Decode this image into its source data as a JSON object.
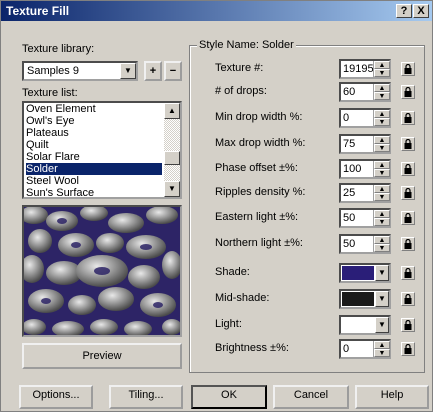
{
  "window": {
    "title": "Texture Fill"
  },
  "titlebar_buttons": {
    "help": "?",
    "close": "X"
  },
  "library": {
    "label": "Texture library:",
    "value": "Samples 9",
    "add": "+",
    "remove": "−"
  },
  "texture_list": {
    "label": "Texture list:",
    "items": [
      "Oven Element",
      "Owl's Eye",
      "Plateaus",
      "Quilt",
      "Solar Flare",
      "Solder",
      "Steel Wool",
      "Sun's Surface"
    ],
    "selected": "Solder"
  },
  "preview_button": "Preview",
  "style_group": {
    "title": "Style Name: Solder"
  },
  "params": [
    {
      "label": "Texture #:",
      "value": "19195"
    },
    {
      "label": "# of drops:",
      "value": "60"
    },
    {
      "label": "Min drop width %:",
      "value": "0"
    },
    {
      "label": "Max drop width %:",
      "value": "75"
    },
    {
      "label": "Phase offset ±%:",
      "value": "100"
    },
    {
      "label": "Ripples density %:",
      "value": "25"
    },
    {
      "label": "Eastern light ±%:",
      "value": "50"
    },
    {
      "label": "Northern light ±%:",
      "value": "50"
    }
  ],
  "colors": [
    {
      "label": "Shade:",
      "color": "#2a1e78"
    },
    {
      "label": "Mid-shade:",
      "color": "#1a1a1a"
    },
    {
      "label": "Light:",
      "color": "#ffffff"
    }
  ],
  "brightness": {
    "label": "Brightness ±%:",
    "value": "0"
  },
  "buttons": {
    "options": "Options...",
    "tiling": "Tiling...",
    "ok": "OK",
    "cancel": "Cancel",
    "help": "Help"
  }
}
